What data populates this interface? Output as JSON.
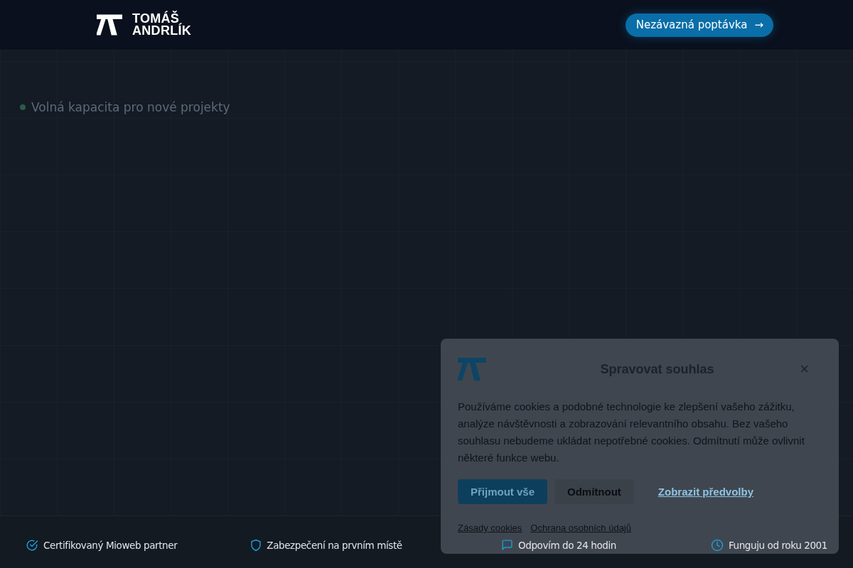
{
  "header": {
    "logo": {
      "line_1": "TOMÁŠ",
      "line_2": "ANDRLÍK"
    },
    "cta_button": {
      "label": "Nezávazná poptávka",
      "arrow": "→"
    }
  },
  "hero": {
    "badge": "Volná kapacita pro nové projekty"
  },
  "footer_bar": {
    "items": [
      {
        "label": "Certifikovaný Mioweb partner"
      },
      {
        "label": "Zabezpečení na prvním místě"
      },
      {
        "label": "Odpovím do 24 hodin"
      },
      {
        "label": "Funguju od roku 2001"
      }
    ]
  },
  "cookie_dialog": {
    "title": "Spravovat souhlas",
    "close": "×",
    "text": "Používáme cookies a podobné technologie ke zlepšení vašeho zážitku, analýze návštěvnosti a zobrazování relevantního obsahu. Bez vašeho souhlasu nebudeme ukládat nepotřebné cookies. Odmítnutí může ovlivnit některé funkce webu.",
    "buttons": [
      {
        "kind": "primary",
        "label": "Přijmout vše"
      },
      {
        "kind": "secondary",
        "label": "Odmítnout"
      },
      {
        "kind": "link",
        "label": "Zobrazit předvolby"
      }
    ],
    "links": [
      "Zásady cookies",
      "Ochrana osobních údajů"
    ]
  }
}
